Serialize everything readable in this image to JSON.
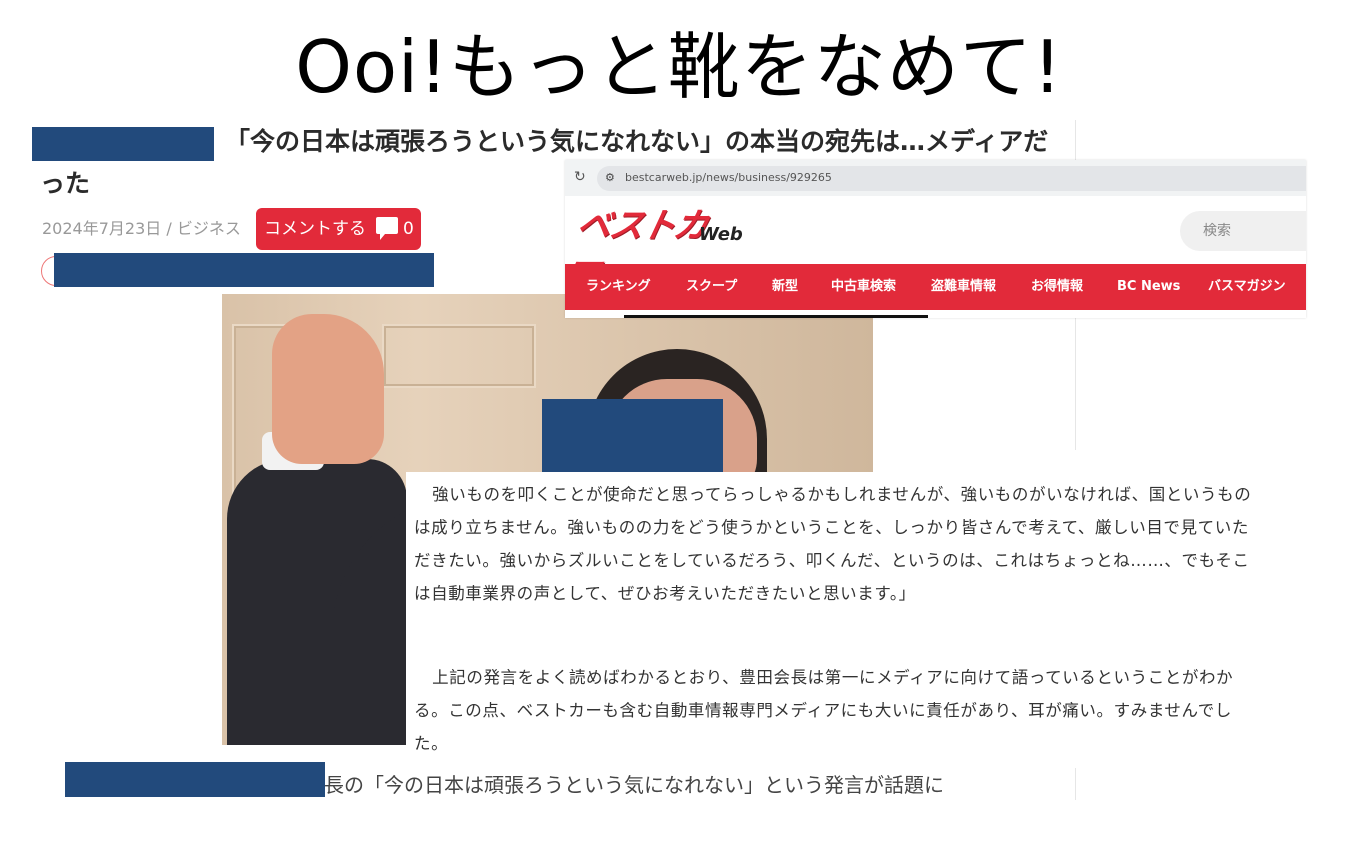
{
  "slide_title": "Ooi!もっと靴をなめて!",
  "article": {
    "headline": "「今の日本は頑張ろうという気になれない」の本当の宛先は…メディアだった",
    "meta": "2024年7月23日 / ビジネス",
    "comment_button_label": "コメントする",
    "comment_count": "0"
  },
  "browser": {
    "url": "bestcarweb.jp/news/business/929265",
    "logo_text": "ベストカー",
    "logo_suffix": "Web",
    "search_placeholder": "検索",
    "nav_items": [
      "ランキング",
      "スクープ",
      "新型",
      "中古車検索",
      "盗難車情報",
      "お得情報",
      "BC News",
      "バスマガジン"
    ]
  },
  "quote": {
    "paragraph1": "強いものを叩くことが使命だと思ってらっしゃるかもしれませんが、強いものがいなければ、国というものは成り立ちません。強いものの力をどう使うかということを、しっかり皆さんで考えて、厳しい目で見ていただきたい。強いからズルいことをしているだろう、叩くんだ、というのは、これはちょっとね……、でもそこは自動車業界の声として、ぜひお考えいただきたいと思います。」",
    "paragraph2": "上記の発言をよく読めばわかるとおり、豊田会長は第一にメディアに向けて語っているということがわかる。この点、ベストカーも含む自動車情報専門メディアにも大いに責任があり、耳が痛い。すみませんでした。"
  },
  "bottom_text": "長の「今の日本は頑張ろうという気になれない」という発言が話題に",
  "colors": {
    "brand_red": "#e22a3a",
    "redaction_blue": "#224a7c"
  }
}
